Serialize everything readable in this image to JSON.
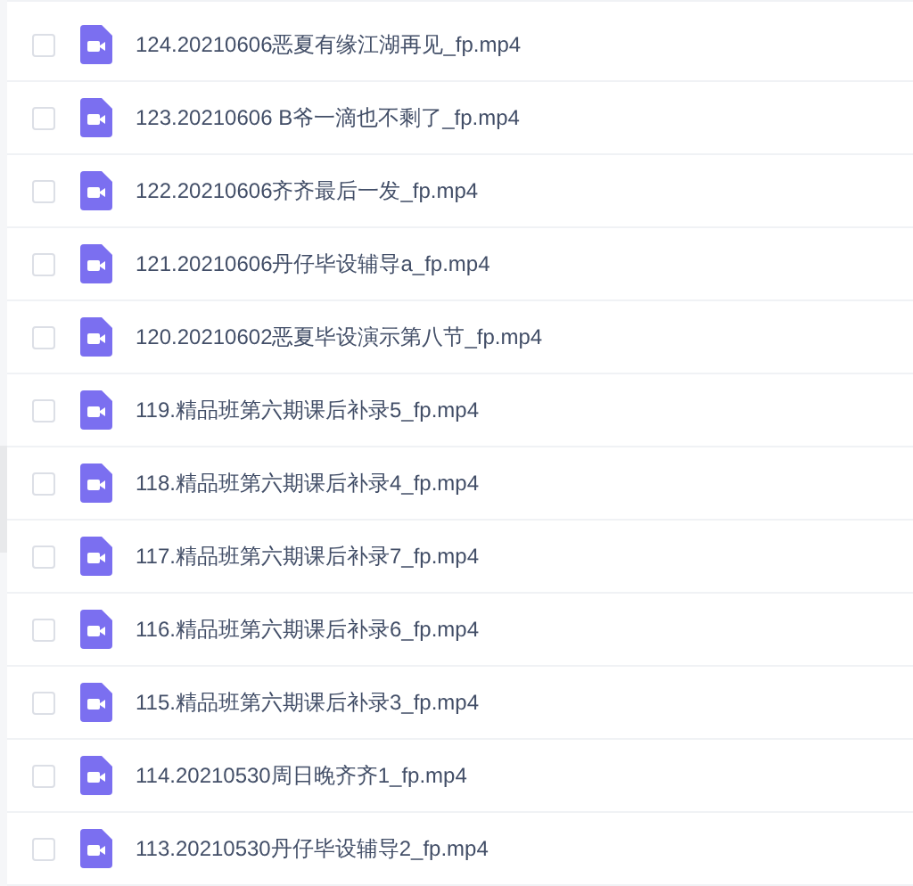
{
  "files": [
    {
      "name": "124.20210606恶夏有缘江湖再见_fp.mp4",
      "checked": false
    },
    {
      "name": "123.20210606 B爷一滴也不剩了_fp.mp4",
      "checked": false
    },
    {
      "name": "122.20210606齐齐最后一发_fp.mp4",
      "checked": false
    },
    {
      "name": "121.20210606丹仔毕设辅导a_fp.mp4",
      "checked": false
    },
    {
      "name": "120.20210602恶夏毕设演示第八节_fp.mp4",
      "checked": false
    },
    {
      "name": "119.精品班第六期课后补录5_fp.mp4",
      "checked": false
    },
    {
      "name": "118.精品班第六期课后补录4_fp.mp4",
      "checked": false
    },
    {
      "name": "117.精品班第六期课后补录7_fp.mp4",
      "checked": false
    },
    {
      "name": "116.精品班第六期课后补录6_fp.mp4",
      "checked": false
    },
    {
      "name": "115.精品班第六期课后补录3_fp.mp4",
      "checked": false
    },
    {
      "name": "114.20210530周日晚齐齐1_fp.mp4",
      "checked": false
    },
    {
      "name": "113.20210530丹仔毕设辅导2_fp.mp4",
      "checked": false
    }
  ]
}
